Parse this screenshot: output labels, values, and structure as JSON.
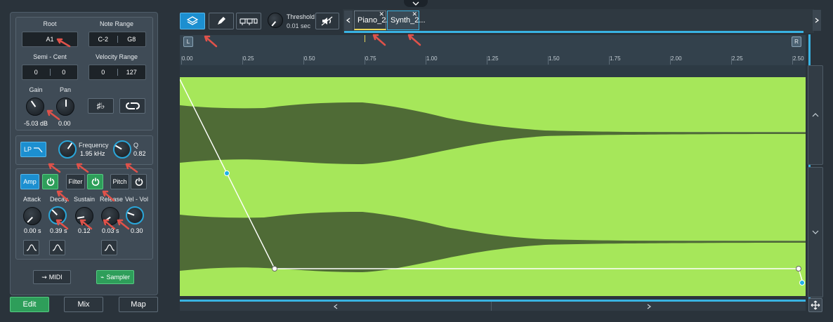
{
  "sample": {
    "root_label": "Root",
    "root_value": "A1",
    "note_range_label": "Note Range",
    "note_low": "C-2",
    "note_high": "G8",
    "semi_cent_label": "Semi - Cent",
    "semi_value": "0",
    "cent_value": "0",
    "velocity_range_label": "Velocity Range",
    "vel_low": "0",
    "vel_high": "127",
    "gain_label": "Gain",
    "gain_value": "-5.03 dB",
    "pan_label": "Pan",
    "pan_value": "0.00"
  },
  "filter": {
    "type_label": "LP",
    "frequency_label": "Frequency",
    "frequency_value": "1.95 kHz",
    "q_label": "Q",
    "q_value": "0.82"
  },
  "envelope": {
    "amp_label": "Amp",
    "filter_label": "Filter",
    "pitch_label": "Pitch",
    "attack_label": "Attack",
    "attack_value": "0.00 s",
    "decay_label": "Decay",
    "decay_value": "0.39 s",
    "sustain_label": "Sustain",
    "sustain_value": "0.12",
    "release_label": "Release",
    "release_value": "0.03 s",
    "velvol_label": "Vel - Vol",
    "velvol_value": "0.30"
  },
  "mode_buttons": {
    "midi": "MIDI",
    "sampler": "Sampler"
  },
  "bottom_tabs": [
    "Edit",
    "Mix",
    "Map"
  ],
  "toolbar": {
    "threshold_label": "Threshold",
    "threshold_value": "0.01 sec"
  },
  "clip_tabs": [
    "Piano_2...",
    "Synth_2..."
  ],
  "ruler": {
    "left_marker": "L",
    "right_marker": "R",
    "ticks": [
      "0.00",
      "0.25",
      "0.50",
      "0.75",
      "1.00",
      "1.25",
      "1.50",
      "1.75",
      "2.00",
      "2.25",
      "2.50"
    ]
  },
  "colors": {
    "accent_blue": "#1c8fd0",
    "active_green": "#2e9e5a",
    "waveform_bg": "#a6e75a",
    "waveform": "#4f6b36",
    "annotation_arrow": "#e0524a"
  }
}
